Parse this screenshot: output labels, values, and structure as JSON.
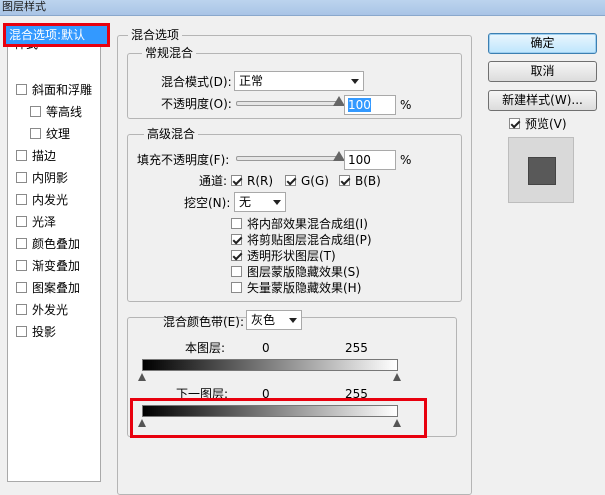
{
  "window": {
    "title": "图层样式"
  },
  "styles_panel": {
    "heading": "样式",
    "selected": "混合选项:默认",
    "items": [
      {
        "label": "斜面和浮雕",
        "checked": false,
        "sub": false
      },
      {
        "label": "等高线",
        "checked": false,
        "sub": true
      },
      {
        "label": "纹理",
        "checked": false,
        "sub": true
      },
      {
        "label": "描边",
        "checked": false,
        "sub": false
      },
      {
        "label": "内阴影",
        "checked": false,
        "sub": false
      },
      {
        "label": "内发光",
        "checked": false,
        "sub": false
      },
      {
        "label": "光泽",
        "checked": false,
        "sub": false
      },
      {
        "label": "颜色叠加",
        "checked": false,
        "sub": false
      },
      {
        "label": "渐变叠加",
        "checked": false,
        "sub": false
      },
      {
        "label": "图案叠加",
        "checked": false,
        "sub": false
      },
      {
        "label": "外发光",
        "checked": false,
        "sub": false
      },
      {
        "label": "投影",
        "checked": false,
        "sub": false
      }
    ]
  },
  "blend_options": {
    "title": "混合选项",
    "general": {
      "title": "常规混合",
      "mode_label": "混合模式(D):",
      "mode_value": "正常",
      "opacity_label": "不透明度(O):",
      "opacity_value": "100",
      "opacity_unit": "%",
      "opacity_level": 1.0
    },
    "advanced": {
      "title": "高级混合",
      "fill_label": "填充不透明度(F):",
      "fill_value": "100",
      "fill_unit": "%",
      "fill_level": 1.0,
      "channels_label": "通道:",
      "channels": [
        {
          "label": "R(R)",
          "checked": true
        },
        {
          "label": "G(G)",
          "checked": true
        },
        {
          "label": "B(B)",
          "checked": true
        }
      ],
      "knockout_label": "挖空(N):",
      "knockout_value": "无",
      "options": [
        {
          "label": "将内部效果混合成组(I)",
          "checked": false
        },
        {
          "label": "将剪贴图层混合成组(P)",
          "checked": true
        },
        {
          "label": "透明形状图层(T)",
          "checked": true
        },
        {
          "label": "图层蒙版隐藏效果(S)",
          "checked": false
        },
        {
          "label": "矢量蒙版隐藏效果(H)",
          "checked": false
        }
      ]
    },
    "blend_if": {
      "label": "混合颜色带(E):",
      "value": "灰色",
      "this_layer": {
        "label": "本图层:",
        "low": "0",
        "high": "255"
      },
      "underlying_layer": {
        "label": "下一图层:",
        "low": "0",
        "high": "255"
      }
    }
  },
  "buttons": {
    "ok": "确定",
    "cancel": "取消",
    "new_style": "新建样式(W)...",
    "preview_label": "预览(V)",
    "preview_checked": true
  },
  "colors": {
    "highlight": "#e8000e",
    "selection": "#3399ff"
  }
}
